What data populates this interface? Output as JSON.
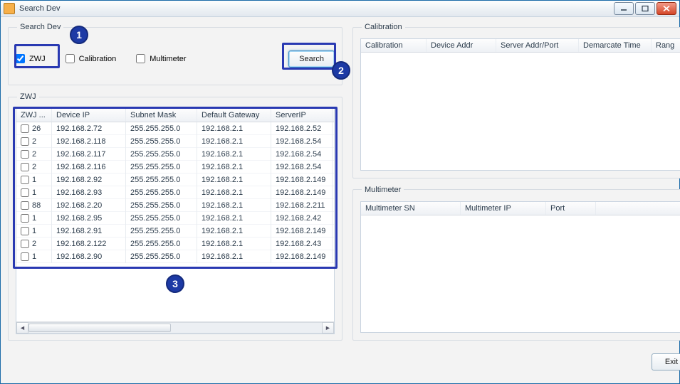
{
  "window": {
    "title": "Search Dev"
  },
  "annotations": {
    "n1": "1",
    "n2": "2",
    "n3": "3"
  },
  "search_group": {
    "legend": "Search Dev",
    "zwj_label": "ZWJ",
    "calibration_label": "Calibration",
    "multimeter_label": "Multimeter",
    "search_button": "Search"
  },
  "zwj_group": {
    "legend": "ZWJ",
    "columns": [
      "ZWJ ...",
      "Device IP",
      "Subnet Mask",
      "Default Gateway",
      "ServerIP"
    ],
    "rows": [
      {
        "zwj": "26",
        "ip": "192.168.2.72",
        "mask": "255.255.255.0",
        "gw": "192.168.2.1",
        "server": "192.168.2.52"
      },
      {
        "zwj": "2",
        "ip": "192.168.2.118",
        "mask": "255.255.255.0",
        "gw": "192.168.2.1",
        "server": "192.168.2.54"
      },
      {
        "zwj": "2",
        "ip": "192.168.2.117",
        "mask": "255.255.255.0",
        "gw": "192.168.2.1",
        "server": "192.168.2.54"
      },
      {
        "zwj": "2",
        "ip": "192.168.2.116",
        "mask": "255.255.255.0",
        "gw": "192.168.2.1",
        "server": "192.168.2.54"
      },
      {
        "zwj": "1",
        "ip": "192.168.2.92",
        "mask": "255.255.255.0",
        "gw": "192.168.2.1",
        "server": "192.168.2.149"
      },
      {
        "zwj": "1",
        "ip": "192.168.2.93",
        "mask": "255.255.255.0",
        "gw": "192.168.2.1",
        "server": "192.168.2.149"
      },
      {
        "zwj": "88",
        "ip": "192.168.2.20",
        "mask": "255.255.255.0",
        "gw": "192.168.2.1",
        "server": "192.168.2.211"
      },
      {
        "zwj": "1",
        "ip": "192.168.2.95",
        "mask": "255.255.255.0",
        "gw": "192.168.2.1",
        "server": "192.168.2.42"
      },
      {
        "zwj": "1",
        "ip": "192.168.2.91",
        "mask": "255.255.255.0",
        "gw": "192.168.2.1",
        "server": "192.168.2.149"
      },
      {
        "zwj": "2",
        "ip": "192.168.2.122",
        "mask": "255.255.255.0",
        "gw": "192.168.2.1",
        "server": "192.168.2.43"
      },
      {
        "zwj": "1",
        "ip": "192.168.2.90",
        "mask": "255.255.255.0",
        "gw": "192.168.2.1",
        "server": "192.168.2.149"
      }
    ]
  },
  "calibration_group": {
    "legend": "Calibration",
    "columns": [
      "Calibration",
      "Device Addr",
      "Server Addr/Port",
      "Demarcate Time",
      "Rang"
    ]
  },
  "multimeter_group": {
    "legend": "Multimeter",
    "columns": [
      "Multimeter SN",
      "Multimeter IP",
      "Port",
      ""
    ]
  },
  "footer": {
    "exit_button": "Exit"
  }
}
